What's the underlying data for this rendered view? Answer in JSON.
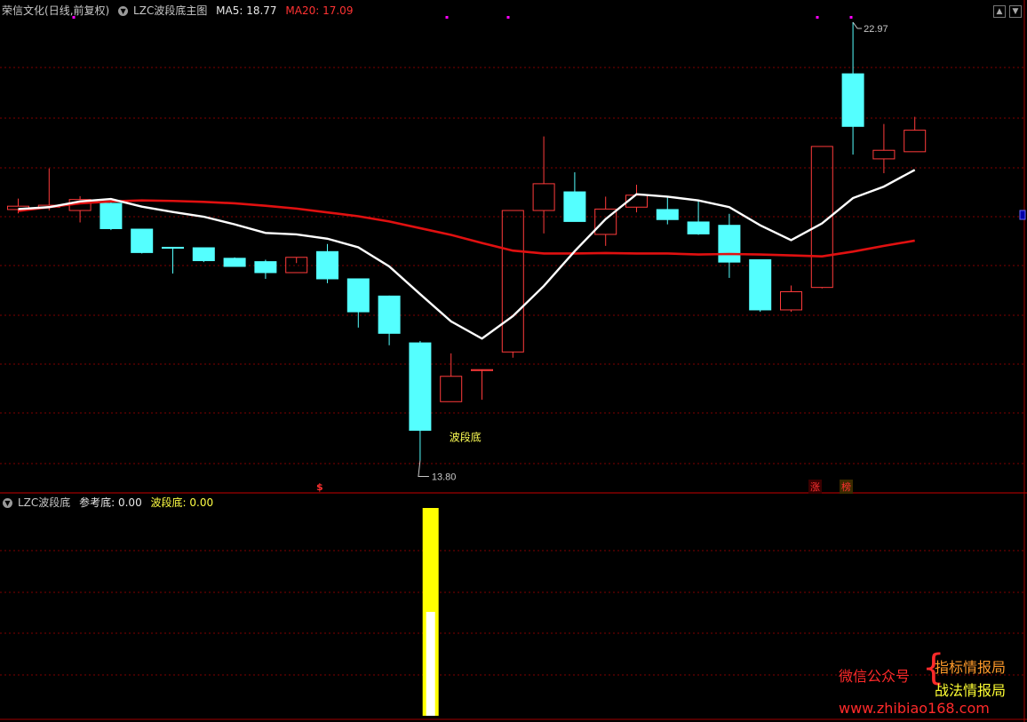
{
  "window": {
    "stock_name": "荣信文化",
    "period_label": "(日线,前复权)",
    "main_indicator": "LZC波段底主图",
    "ma5_text": "MA5: 18.77",
    "ma20_text": "MA20: 17.09",
    "sub_indicator": "LZC波段底",
    "ref_bottom_text": "参考底: 0.00",
    "wave_bottom_text": "波段底: 0.00"
  },
  "colors": {
    "background": "#000000",
    "up_candle": "#ff3b3b",
    "down_candle": "#54ffff",
    "ma5": "#ffffff",
    "ma20": "#e01010",
    "grid": "#800000",
    "signal_bar": "#ffff00",
    "magenta_marker": "#ff00ff"
  },
  "chart_data": [
    {
      "type": "candlestick",
      "title": "LZC波段底主图",
      "ylim": [
        13.4,
        23.1
      ],
      "candles": [
        {
          "o": 19.05,
          "h": 19.28,
          "l": 18.97,
          "c": 19.12
        },
        {
          "o": 19.1,
          "h": 19.91,
          "l": 19.03,
          "c": 19.14
        },
        {
          "o": 19.03,
          "h": 19.33,
          "l": 18.78,
          "c": 19.26
        },
        {
          "o": 19.18,
          "h": 19.21,
          "l": 18.62,
          "c": 18.65
        },
        {
          "o": 18.64,
          "h": 18.63,
          "l": 18.13,
          "c": 18.15
        },
        {
          "o": 18.26,
          "h": 18.24,
          "l": 17.71,
          "c": 18.24
        },
        {
          "o": 18.25,
          "h": 18.24,
          "l": 17.95,
          "c": 17.98
        },
        {
          "o": 18.03,
          "h": 18.05,
          "l": 17.89,
          "c": 17.86
        },
        {
          "o": 17.96,
          "h": 18.0,
          "l": 17.6,
          "c": 17.73
        },
        {
          "o": 17.73,
          "h": 17.93,
          "l": 17.73,
          "c": 18.05
        },
        {
          "o": 18.17,
          "h": 18.33,
          "l": 17.51,
          "c": 17.6
        },
        {
          "o": 17.6,
          "h": 17.54,
          "l": 16.58,
          "c": 16.91
        },
        {
          "o": 17.24,
          "h": 17.25,
          "l": 16.21,
          "c": 16.46
        },
        {
          "o": 16.26,
          "h": 16.3,
          "l": 13.8,
          "c": 14.43
        },
        {
          "o": 15.03,
          "h": 16.04,
          "l": 15.03,
          "c": 15.56
        },
        {
          "o": 15.68,
          "h": 15.68,
          "l": 15.07,
          "c": 15.7
        },
        {
          "o": 16.07,
          "h": 19.03,
          "l": 15.95,
          "c": 19.03
        },
        {
          "o": 19.03,
          "h": 20.58,
          "l": 18.55,
          "c": 19.59
        },
        {
          "o": 19.42,
          "h": 19.83,
          "l": 18.8,
          "c": 18.8
        },
        {
          "o": 18.53,
          "h": 19.32,
          "l": 18.29,
          "c": 19.06
        },
        {
          "o": 19.1,
          "h": 19.57,
          "l": 18.99,
          "c": 19.35
        },
        {
          "o": 19.05,
          "h": 19.33,
          "l": 18.74,
          "c": 18.84
        },
        {
          "o": 18.79,
          "h": 19.23,
          "l": 18.52,
          "c": 18.54
        },
        {
          "o": 18.72,
          "h": 18.96,
          "l": 17.62,
          "c": 17.95
        },
        {
          "o": 18.0,
          "h": 17.96,
          "l": 16.91,
          "c": 16.95
        },
        {
          "o": 16.95,
          "h": 17.46,
          "l": 16.91,
          "c": 17.33
        },
        {
          "o": 17.42,
          "h": 20.37,
          "l": 17.4,
          "c": 20.37
        },
        {
          "o": 21.89,
          "h": 22.97,
          "l": 20.2,
          "c": 20.79
        },
        {
          "o": 20.11,
          "h": 20.84,
          "l": 19.81,
          "c": 20.29
        },
        {
          "o": 20.26,
          "h": 20.99,
          "l": 20.26,
          "c": 20.71
        }
      ],
      "ma5": [
        19.06,
        19.1,
        19.22,
        19.27,
        19.11,
        19.0,
        18.9,
        18.74,
        18.56,
        18.53,
        18.44,
        18.26,
        17.86,
        17.28,
        16.71,
        16.35,
        16.82,
        17.45,
        18.18,
        18.85,
        19.37,
        19.32,
        19.24,
        19.1,
        18.72,
        18.41,
        18.76,
        19.29,
        19.53,
        19.88
      ],
      "ma20": [
        19.02,
        19.1,
        19.18,
        19.22,
        19.24,
        19.23,
        19.21,
        19.18,
        19.13,
        19.07,
        18.99,
        18.91,
        18.8,
        18.66,
        18.52,
        18.35,
        18.19,
        18.13,
        18.13,
        18.14,
        18.13,
        18.13,
        18.11,
        18.12,
        18.11,
        18.09,
        18.07,
        18.17,
        18.29,
        18.4
      ],
      "max_label": "22.97",
      "min_label": "13.80",
      "signal_label": "波段底",
      "signal_index": 14
    },
    {
      "type": "bar",
      "title": "LZC波段底",
      "ylim": [
        0,
        1
      ],
      "series": [
        {
          "name": "参考底",
          "values": [
            0,
            0,
            0,
            0,
            0,
            0,
            0,
            0,
            0,
            0,
            0,
            0,
            0,
            0,
            0.5,
            0,
            0,
            0,
            0,
            0,
            0,
            0,
            0,
            0,
            0,
            0,
            0,
            0,
            0,
            0
          ]
        },
        {
          "name": "波段底",
          "values": [
            0,
            0,
            0,
            0,
            0,
            0,
            0,
            0,
            0,
            0,
            0,
            0,
            0,
            0,
            1.0,
            0,
            0,
            0,
            0,
            0,
            0,
            0,
            0,
            0,
            0,
            0,
            0,
            0,
            0,
            0
          ]
        }
      ]
    }
  ],
  "markers": {
    "dollar": "$",
    "zhang": "涨",
    "bang": "榜"
  },
  "watermark": {
    "wechat_label": "微信公众号",
    "brace": "{",
    "line1": "指标情报局",
    "line2": "战法情报局",
    "url": "www.zhibiao168.com"
  },
  "nav": {
    "up_icon": "chevron-up-icon",
    "down_icon": "chevron-down-icon"
  }
}
